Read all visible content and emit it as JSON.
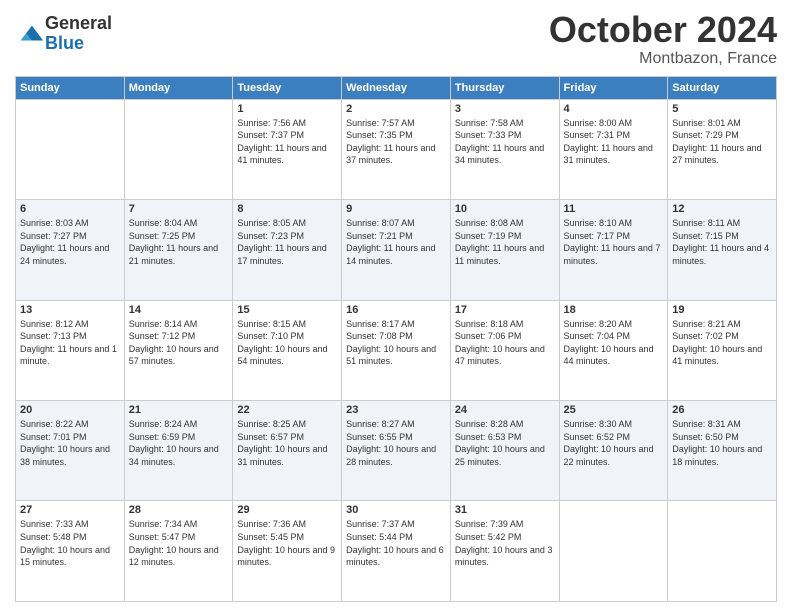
{
  "logo": {
    "general": "General",
    "blue": "Blue"
  },
  "header": {
    "month": "October 2024",
    "location": "Montbazon, France"
  },
  "weekdays": [
    "Sunday",
    "Monday",
    "Tuesday",
    "Wednesday",
    "Thursday",
    "Friday",
    "Saturday"
  ],
  "weeks": [
    [
      {
        "day": "",
        "sunrise": "",
        "sunset": "",
        "daylight": ""
      },
      {
        "day": "",
        "sunrise": "",
        "sunset": "",
        "daylight": ""
      },
      {
        "day": "1",
        "sunrise": "Sunrise: 7:56 AM",
        "sunset": "Sunset: 7:37 PM",
        "daylight": "Daylight: 11 hours and 41 minutes."
      },
      {
        "day": "2",
        "sunrise": "Sunrise: 7:57 AM",
        "sunset": "Sunset: 7:35 PM",
        "daylight": "Daylight: 11 hours and 37 minutes."
      },
      {
        "day": "3",
        "sunrise": "Sunrise: 7:58 AM",
        "sunset": "Sunset: 7:33 PM",
        "daylight": "Daylight: 11 hours and 34 minutes."
      },
      {
        "day": "4",
        "sunrise": "Sunrise: 8:00 AM",
        "sunset": "Sunset: 7:31 PM",
        "daylight": "Daylight: 11 hours and 31 minutes."
      },
      {
        "day": "5",
        "sunrise": "Sunrise: 8:01 AM",
        "sunset": "Sunset: 7:29 PM",
        "daylight": "Daylight: 11 hours and 27 minutes."
      }
    ],
    [
      {
        "day": "6",
        "sunrise": "Sunrise: 8:03 AM",
        "sunset": "Sunset: 7:27 PM",
        "daylight": "Daylight: 11 hours and 24 minutes."
      },
      {
        "day": "7",
        "sunrise": "Sunrise: 8:04 AM",
        "sunset": "Sunset: 7:25 PM",
        "daylight": "Daylight: 11 hours and 21 minutes."
      },
      {
        "day": "8",
        "sunrise": "Sunrise: 8:05 AM",
        "sunset": "Sunset: 7:23 PM",
        "daylight": "Daylight: 11 hours and 17 minutes."
      },
      {
        "day": "9",
        "sunrise": "Sunrise: 8:07 AM",
        "sunset": "Sunset: 7:21 PM",
        "daylight": "Daylight: 11 hours and 14 minutes."
      },
      {
        "day": "10",
        "sunrise": "Sunrise: 8:08 AM",
        "sunset": "Sunset: 7:19 PM",
        "daylight": "Daylight: 11 hours and 11 minutes."
      },
      {
        "day": "11",
        "sunrise": "Sunrise: 8:10 AM",
        "sunset": "Sunset: 7:17 PM",
        "daylight": "Daylight: 11 hours and 7 minutes."
      },
      {
        "day": "12",
        "sunrise": "Sunrise: 8:11 AM",
        "sunset": "Sunset: 7:15 PM",
        "daylight": "Daylight: 11 hours and 4 minutes."
      }
    ],
    [
      {
        "day": "13",
        "sunrise": "Sunrise: 8:12 AM",
        "sunset": "Sunset: 7:13 PM",
        "daylight": "Daylight: 11 hours and 1 minute."
      },
      {
        "day": "14",
        "sunrise": "Sunrise: 8:14 AM",
        "sunset": "Sunset: 7:12 PM",
        "daylight": "Daylight: 10 hours and 57 minutes."
      },
      {
        "day": "15",
        "sunrise": "Sunrise: 8:15 AM",
        "sunset": "Sunset: 7:10 PM",
        "daylight": "Daylight: 10 hours and 54 minutes."
      },
      {
        "day": "16",
        "sunrise": "Sunrise: 8:17 AM",
        "sunset": "Sunset: 7:08 PM",
        "daylight": "Daylight: 10 hours and 51 minutes."
      },
      {
        "day": "17",
        "sunrise": "Sunrise: 8:18 AM",
        "sunset": "Sunset: 7:06 PM",
        "daylight": "Daylight: 10 hours and 47 minutes."
      },
      {
        "day": "18",
        "sunrise": "Sunrise: 8:20 AM",
        "sunset": "Sunset: 7:04 PM",
        "daylight": "Daylight: 10 hours and 44 minutes."
      },
      {
        "day": "19",
        "sunrise": "Sunrise: 8:21 AM",
        "sunset": "Sunset: 7:02 PM",
        "daylight": "Daylight: 10 hours and 41 minutes."
      }
    ],
    [
      {
        "day": "20",
        "sunrise": "Sunrise: 8:22 AM",
        "sunset": "Sunset: 7:01 PM",
        "daylight": "Daylight: 10 hours and 38 minutes."
      },
      {
        "day": "21",
        "sunrise": "Sunrise: 8:24 AM",
        "sunset": "Sunset: 6:59 PM",
        "daylight": "Daylight: 10 hours and 34 minutes."
      },
      {
        "day": "22",
        "sunrise": "Sunrise: 8:25 AM",
        "sunset": "Sunset: 6:57 PM",
        "daylight": "Daylight: 10 hours and 31 minutes."
      },
      {
        "day": "23",
        "sunrise": "Sunrise: 8:27 AM",
        "sunset": "Sunset: 6:55 PM",
        "daylight": "Daylight: 10 hours and 28 minutes."
      },
      {
        "day": "24",
        "sunrise": "Sunrise: 8:28 AM",
        "sunset": "Sunset: 6:53 PM",
        "daylight": "Daylight: 10 hours and 25 minutes."
      },
      {
        "day": "25",
        "sunrise": "Sunrise: 8:30 AM",
        "sunset": "Sunset: 6:52 PM",
        "daylight": "Daylight: 10 hours and 22 minutes."
      },
      {
        "day": "26",
        "sunrise": "Sunrise: 8:31 AM",
        "sunset": "Sunset: 6:50 PM",
        "daylight": "Daylight: 10 hours and 18 minutes."
      }
    ],
    [
      {
        "day": "27",
        "sunrise": "Sunrise: 7:33 AM",
        "sunset": "Sunset: 5:48 PM",
        "daylight": "Daylight: 10 hours and 15 minutes."
      },
      {
        "day": "28",
        "sunrise": "Sunrise: 7:34 AM",
        "sunset": "Sunset: 5:47 PM",
        "daylight": "Daylight: 10 hours and 12 minutes."
      },
      {
        "day": "29",
        "sunrise": "Sunrise: 7:36 AM",
        "sunset": "Sunset: 5:45 PM",
        "daylight": "Daylight: 10 hours and 9 minutes."
      },
      {
        "day": "30",
        "sunrise": "Sunrise: 7:37 AM",
        "sunset": "Sunset: 5:44 PM",
        "daylight": "Daylight: 10 hours and 6 minutes."
      },
      {
        "day": "31",
        "sunrise": "Sunrise: 7:39 AM",
        "sunset": "Sunset: 5:42 PM",
        "daylight": "Daylight: 10 hours and 3 minutes."
      },
      {
        "day": "",
        "sunrise": "",
        "sunset": "",
        "daylight": ""
      },
      {
        "day": "",
        "sunrise": "",
        "sunset": "",
        "daylight": ""
      }
    ]
  ]
}
